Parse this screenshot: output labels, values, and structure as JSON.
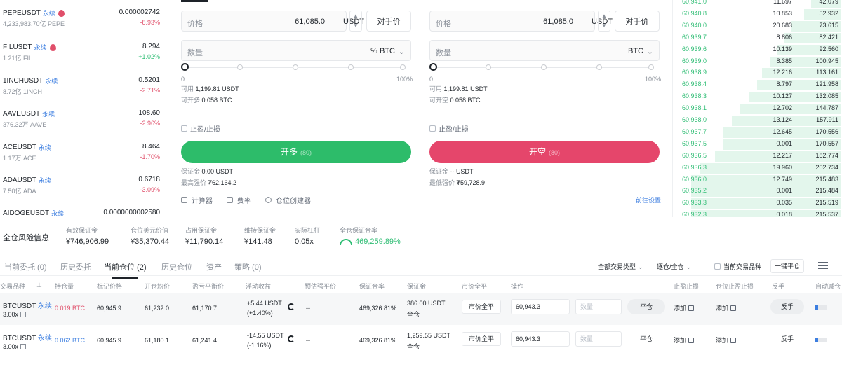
{
  "market_list": [
    {
      "symbol": "PEPEUSDT",
      "tag": "永续",
      "hot": true,
      "volume": "4,233,983.70亿 PEPE",
      "price": "0.000002742",
      "change": "-8.93%",
      "dir": "down"
    },
    {
      "symbol": "FILUSDT",
      "tag": "永续",
      "hot": true,
      "volume": "1.21亿 FIL",
      "price": "8.294",
      "change": "+1.02%",
      "dir": "up"
    },
    {
      "symbol": "1INCHUSDT",
      "tag": "永续",
      "hot": false,
      "volume": "8.72亿 1INCH",
      "price": "0.5201",
      "change": "-2.71%",
      "dir": "down"
    },
    {
      "symbol": "AAVEUSDT",
      "tag": "永续",
      "hot": false,
      "volume": "376.32万 AAVE",
      "price": "108.60",
      "change": "-2.96%",
      "dir": "down"
    },
    {
      "symbol": "ACEUSDT",
      "tag": "永续",
      "hot": false,
      "volume": "1.17万 ACE",
      "price": "8.464",
      "change": "-1.70%",
      "dir": "down"
    },
    {
      "symbol": "ADAUSDT",
      "tag": "永续",
      "hot": false,
      "volume": "7.50亿 ADA",
      "price": "0.6718",
      "change": "-3.09%",
      "dir": "down"
    },
    {
      "symbol": "AIDOGEUSDT",
      "tag": "永续",
      "hot": false,
      "volume": "",
      "price": "0.0000000002580",
      "change": "",
      "dir": "down"
    }
  ],
  "order_long": {
    "price_label": "价格",
    "price_value": "61,085.0",
    "price_unit": "USDT",
    "counter_price": "对手价",
    "qty_label": "数量",
    "qty_unit": "%  BTC",
    "slider_min": "0",
    "slider_max": "100%",
    "available_label": "可用",
    "available_value": "1,199.81 USDT",
    "max_label": "可开多",
    "max_value": "0.058 BTC",
    "tpsl": "止盈/止损",
    "button_label": "开多",
    "button_sub": "(80)",
    "margin_label": "保证金",
    "margin_value": "0.00 USDT",
    "liq_label": "最高强价",
    "liq_value": "₮62,164.2"
  },
  "order_short": {
    "price_label": "价格",
    "price_value": "61,085.0",
    "price_unit": "USDT",
    "counter_price": "对手价",
    "qty_label": "数量",
    "qty_unit": "BTC",
    "slider_min": "0",
    "slider_max": "100%",
    "available_label": "可用",
    "available_value": "1,199.81 USDT",
    "max_label": "可开空",
    "max_value": "0.058 BTC",
    "tpsl": "止盈/止损",
    "button_label": "开空",
    "button_sub": "(80)",
    "margin_label": "保证金",
    "margin_value": "-- USDT",
    "liq_label": "最低强价",
    "liq_value": "₮59,728.9"
  },
  "tools": {
    "calculator": "计算器",
    "fee_rate": "费率",
    "position_builder": "仓位创建器",
    "more_link": "前往设置"
  },
  "order_book": [
    {
      "price": "60,941.0",
      "qty": "11.697",
      "total": "42.079",
      "depth": 0.18
    },
    {
      "price": "60,940.8",
      "qty": "10.853",
      "total": "52.932",
      "depth": 0.22
    },
    {
      "price": "60,940.0",
      "qty": "20.683",
      "total": "73.615",
      "depth": 0.3
    },
    {
      "price": "60,939.7",
      "qty": "8.806",
      "total": "82.421",
      "depth": 0.34
    },
    {
      "price": "60,939.6",
      "qty": "10.139",
      "price_alt": "",
      "total": "92.560",
      "depth": 0.38
    },
    {
      "price": "60,939.0",
      "qty": "8.385",
      "total": "100.945",
      "depth": 0.42
    },
    {
      "price": "60,938.9",
      "qty": "12.216",
      "total": "113.161",
      "depth": 0.47
    },
    {
      "price": "60,938.4",
      "qty": "8.797",
      "total": "121.958",
      "depth": 0.5
    },
    {
      "price": "60,938.3",
      "qty": "10.127",
      "total": "132.085",
      "depth": 0.55
    },
    {
      "price": "60,938.1",
      "qty": "12.702",
      "total": "144.787",
      "depth": 0.6
    },
    {
      "price": "60,938.0",
      "qty": "13.124",
      "total": "157.911",
      "depth": 0.65
    },
    {
      "price": "60,937.7",
      "qty": "12.645",
      "total": "170.556",
      "depth": 0.7
    },
    {
      "price": "60,937.5",
      "qty": "0.001",
      "total": "170.557",
      "depth": 0.7
    },
    {
      "price": "60,936.5",
      "qty": "12.217",
      "total": "182.774",
      "depth": 0.75
    },
    {
      "price": "60,936.3",
      "qty": "19.960",
      "total": "202.734",
      "depth": 0.84
    },
    {
      "price": "60,936.0",
      "qty": "12.749",
      "total": "215.483",
      "depth": 0.89
    },
    {
      "price": "60,935.2",
      "qty": "0.001",
      "total": "215.484",
      "depth": 0.89
    },
    {
      "price": "60,933.3",
      "qty": "0.035",
      "total": "215.519",
      "depth": 0.89
    },
    {
      "price": "60,932.3",
      "qty": "0.018",
      "total": "215.537",
      "depth": 0.89
    }
  ],
  "risk": {
    "title": "全仓风险信息",
    "items": [
      {
        "label": "有效保证金",
        "value": "¥746,906.99"
      },
      {
        "label": "仓位美元价值",
        "value": "¥35,370.44"
      },
      {
        "label": "占用保证金",
        "value": "¥11,790.14"
      },
      {
        "label": "维持保证金",
        "value": "¥141.48"
      },
      {
        "label": "实际杠杆",
        "value": "0.05x"
      },
      {
        "label": "全仓保证金率",
        "value": "469,259.89%"
      }
    ]
  },
  "tabs": [
    "当前委托 (0)",
    "历史委托",
    "当前仓位 (2)",
    "历史仓位",
    "资产",
    "策略 (0)"
  ],
  "filters": {
    "all_types": "全部交易类型",
    "margin_mode": "逐仓/全仓",
    "current_only": "当前交易品种",
    "close_all": "一键平仓"
  },
  "table_headers": [
    "交易品种",
    "持仓量",
    "标记价格",
    "开仓均价",
    "盈亏平衡价",
    "浮动收益",
    "预估强平价",
    "保证金率",
    "保证金",
    "市价全平",
    "操作",
    "止盈止损",
    "仓位止盈止损",
    "反手",
    "自动减仓"
  ],
  "positions": [
    {
      "symbol": "BTCUSDT",
      "tag": "永续",
      "leverage": "3.00x",
      "qty": "0.019 BTC",
      "mark": "60,945.9",
      "entry": "61,232.0",
      "breakeven": "61,170.7",
      "pnl": "+5.44 USDT",
      "pnl_pct": "(+1.40%)",
      "pnl_dir": "up",
      "liq": "--",
      "margin_ratio": "469,326.81%",
      "margin": "386.00 USDT",
      "margin_mode": "全仓",
      "market_close": "市价全平",
      "price_input": "60,943.3",
      "qty_placeholder": "数量",
      "close_label": "平仓",
      "add1": "添加",
      "add2": "添加",
      "reverse": "反手"
    },
    {
      "symbol": "BTCUSDT",
      "tag": "永续",
      "leverage": "3.00x",
      "qty": "0.062 BTC",
      "mark": "60,945.9",
      "entry": "61,180.1",
      "breakeven": "61,241.4",
      "pnl": "-14.55 USDT",
      "pnl_pct": "(-1.16%)",
      "pnl_dir": "down",
      "liq": "--",
      "margin_ratio": "469,326.81%",
      "margin": "1,259.55 USDT",
      "margin_mode": "全仓",
      "market_close": "市价全平",
      "price_input": "60,943.3",
      "qty_placeholder": "数量",
      "close_label": "平仓",
      "add1": "添加",
      "add2": "添加",
      "reverse": "反手"
    }
  ],
  "colors": {
    "long": "#2dbc6a",
    "short": "#e5466b",
    "up": "#2fbd74",
    "down": "#e04f6a",
    "link": "#3c7ee0"
  }
}
